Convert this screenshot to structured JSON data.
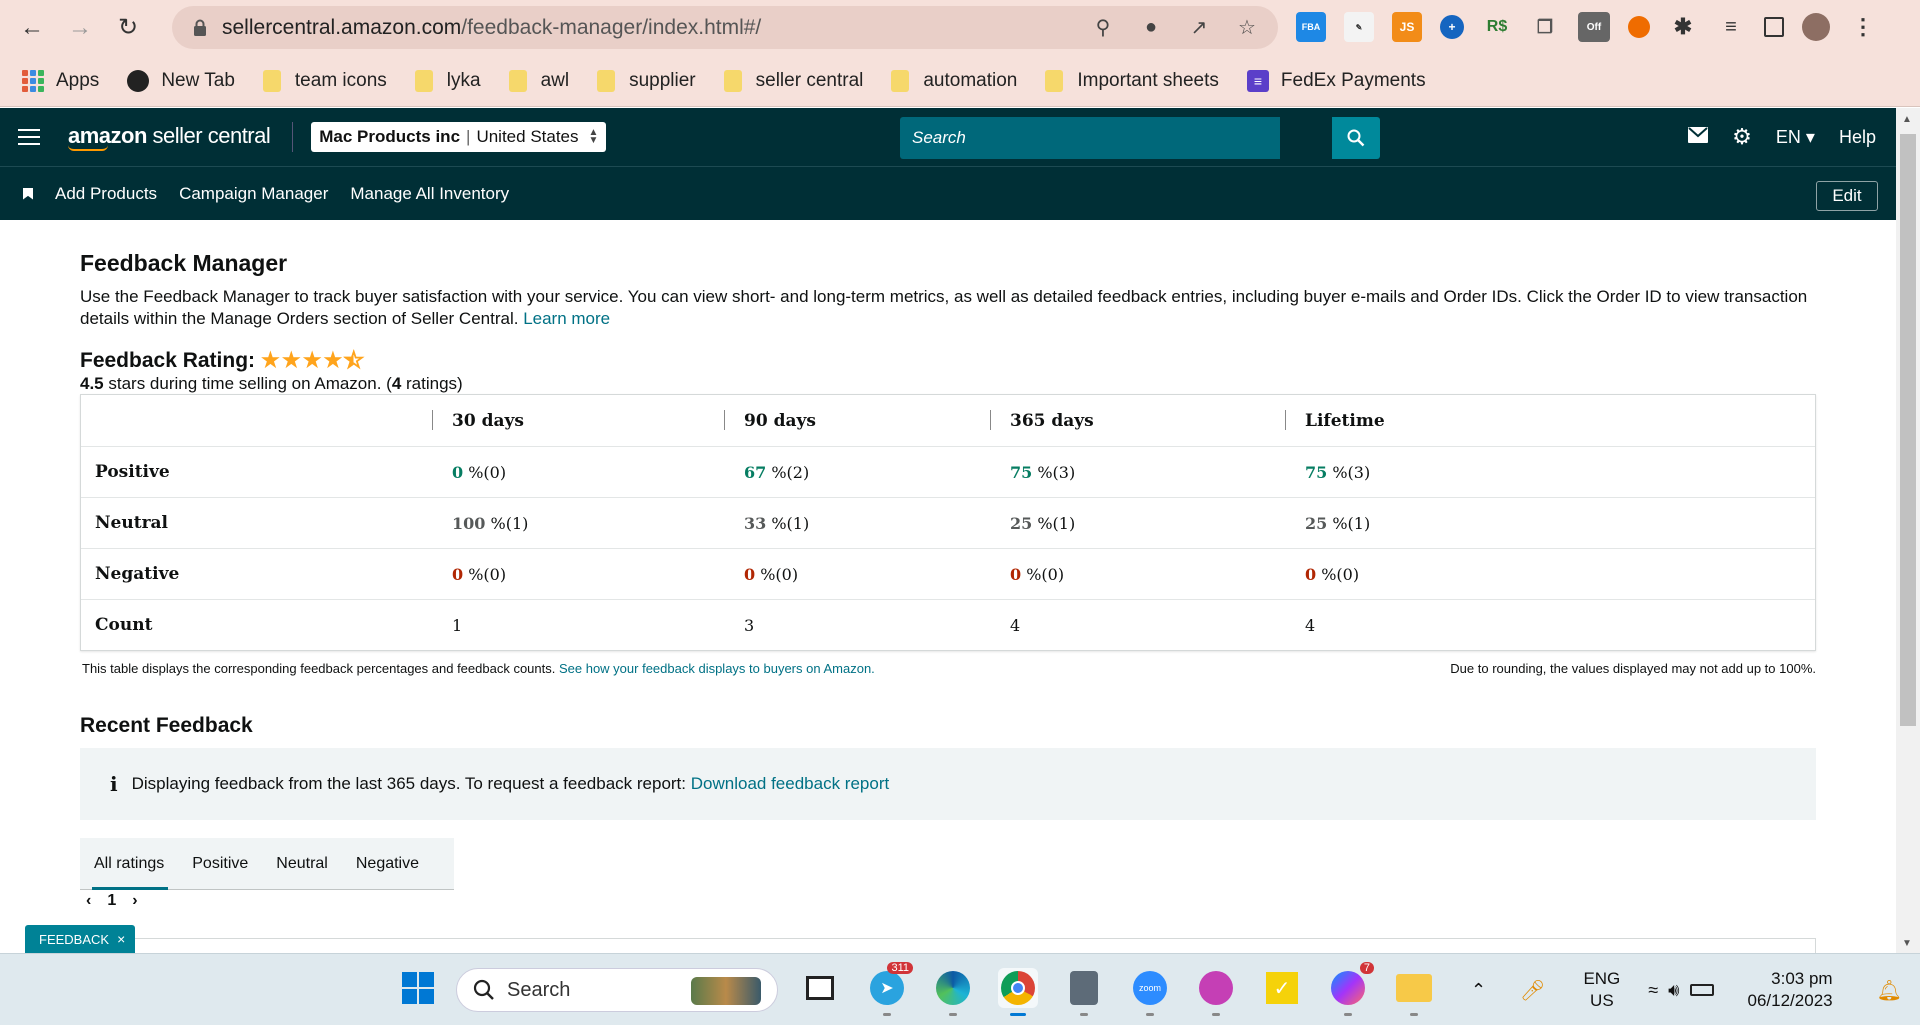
{
  "browser": {
    "url_host": "sellercentral.amazon.com",
    "url_path": "/feedback-manager/index.html#/",
    "bookmarks": [
      {
        "label": "Apps",
        "icon": "apps-grid-icon"
      },
      {
        "label": "New Tab",
        "icon": "globe-icon"
      },
      {
        "label": "team icons",
        "icon": "folder-icon"
      },
      {
        "label": "lyka",
        "icon": "folder-icon"
      },
      {
        "label": "awl",
        "icon": "folder-icon"
      },
      {
        "label": "supplier",
        "icon": "folder-icon"
      },
      {
        "label": "seller central",
        "icon": "folder-icon"
      },
      {
        "label": "automation",
        "icon": "folder-icon"
      },
      {
        "label": "Important sheets",
        "icon": "folder-icon"
      },
      {
        "label": "FedEx Payments",
        "icon": "list-icon"
      }
    ],
    "extension_labels": {
      "fba": "FBA",
      "js": "JS",
      "rs": "R$",
      "off": "Off"
    }
  },
  "header": {
    "logo_bold": "amazon",
    "logo_rest": " seller central",
    "account_name": "Mac Products inc",
    "account_region": "United States",
    "search_placeholder": "Search",
    "language": "EN",
    "help": "Help"
  },
  "subnav": {
    "links": [
      "Add Products",
      "Campaign Manager",
      "Manage All Inventory"
    ],
    "edit": "Edit"
  },
  "page": {
    "title": "Feedback Manager",
    "intro": "Use the Feedback Manager to track buyer satisfaction with your service. You can view short- and long-term metrics, as well as detailed feedback entries, including buyer e-mails and Order IDs. Click the Order ID to view transaction details within the Manage Orders section of Seller Central.",
    "learn_more": "Learn more",
    "rating_title": "Feedback Rating:",
    "rating_stars": 4.5,
    "rating_value": "4.5",
    "rating_mid": " stars during time selling on Amazon. (",
    "rating_count": "4",
    "rating_end": " ratings)"
  },
  "table": {
    "columns": [
      "30 days",
      "90 days",
      "365 days",
      "Lifetime"
    ],
    "rows": [
      {
        "label": "Positive",
        "cells": [
          [
            "0",
            " %(0)"
          ],
          [
            "67",
            " %(2)"
          ],
          [
            "75",
            " %(3)"
          ],
          [
            "75",
            " %(3)"
          ]
        ]
      },
      {
        "label": "Neutral",
        "cells": [
          [
            "100",
            " %(1)"
          ],
          [
            "33",
            " %(1)"
          ],
          [
            "25",
            " %(1)"
          ],
          [
            "25",
            " %(1)"
          ]
        ]
      },
      {
        "label": "Negative",
        "cells": [
          [
            "0",
            " %(0)"
          ],
          [
            "0",
            " %(0)"
          ],
          [
            "0",
            " %(0)"
          ],
          [
            "0",
            " %(0)"
          ]
        ]
      },
      {
        "label": "Count",
        "cells": [
          [
            "1",
            ""
          ],
          [
            "3",
            ""
          ],
          [
            "4",
            ""
          ],
          [
            "4",
            ""
          ]
        ]
      }
    ],
    "note_left": "This table displays the corresponding feedback percentages and feedback counts.",
    "note_link": "See how your feedback displays to buyers on Amazon.",
    "note_right": "Due to rounding, the values displayed may not add up to 100%."
  },
  "recent": {
    "title": "Recent Feedback",
    "info": "Displaying feedback from the last 365 days. To request a feedback report:",
    "info_link": "Download feedback report",
    "tabs": [
      "All ratings",
      "Positive",
      "Neutral",
      "Negative"
    ],
    "active_tab": "All ratings",
    "page": "1"
  },
  "feedback_widget": "FEEDBACK",
  "taskbar": {
    "search": "Search",
    "telegram_badge": "311",
    "messenger_badge": "7",
    "lang_top": "ENG",
    "lang_bottom": "US",
    "time": "3:03 pm",
    "date": "06/12/2023"
  }
}
